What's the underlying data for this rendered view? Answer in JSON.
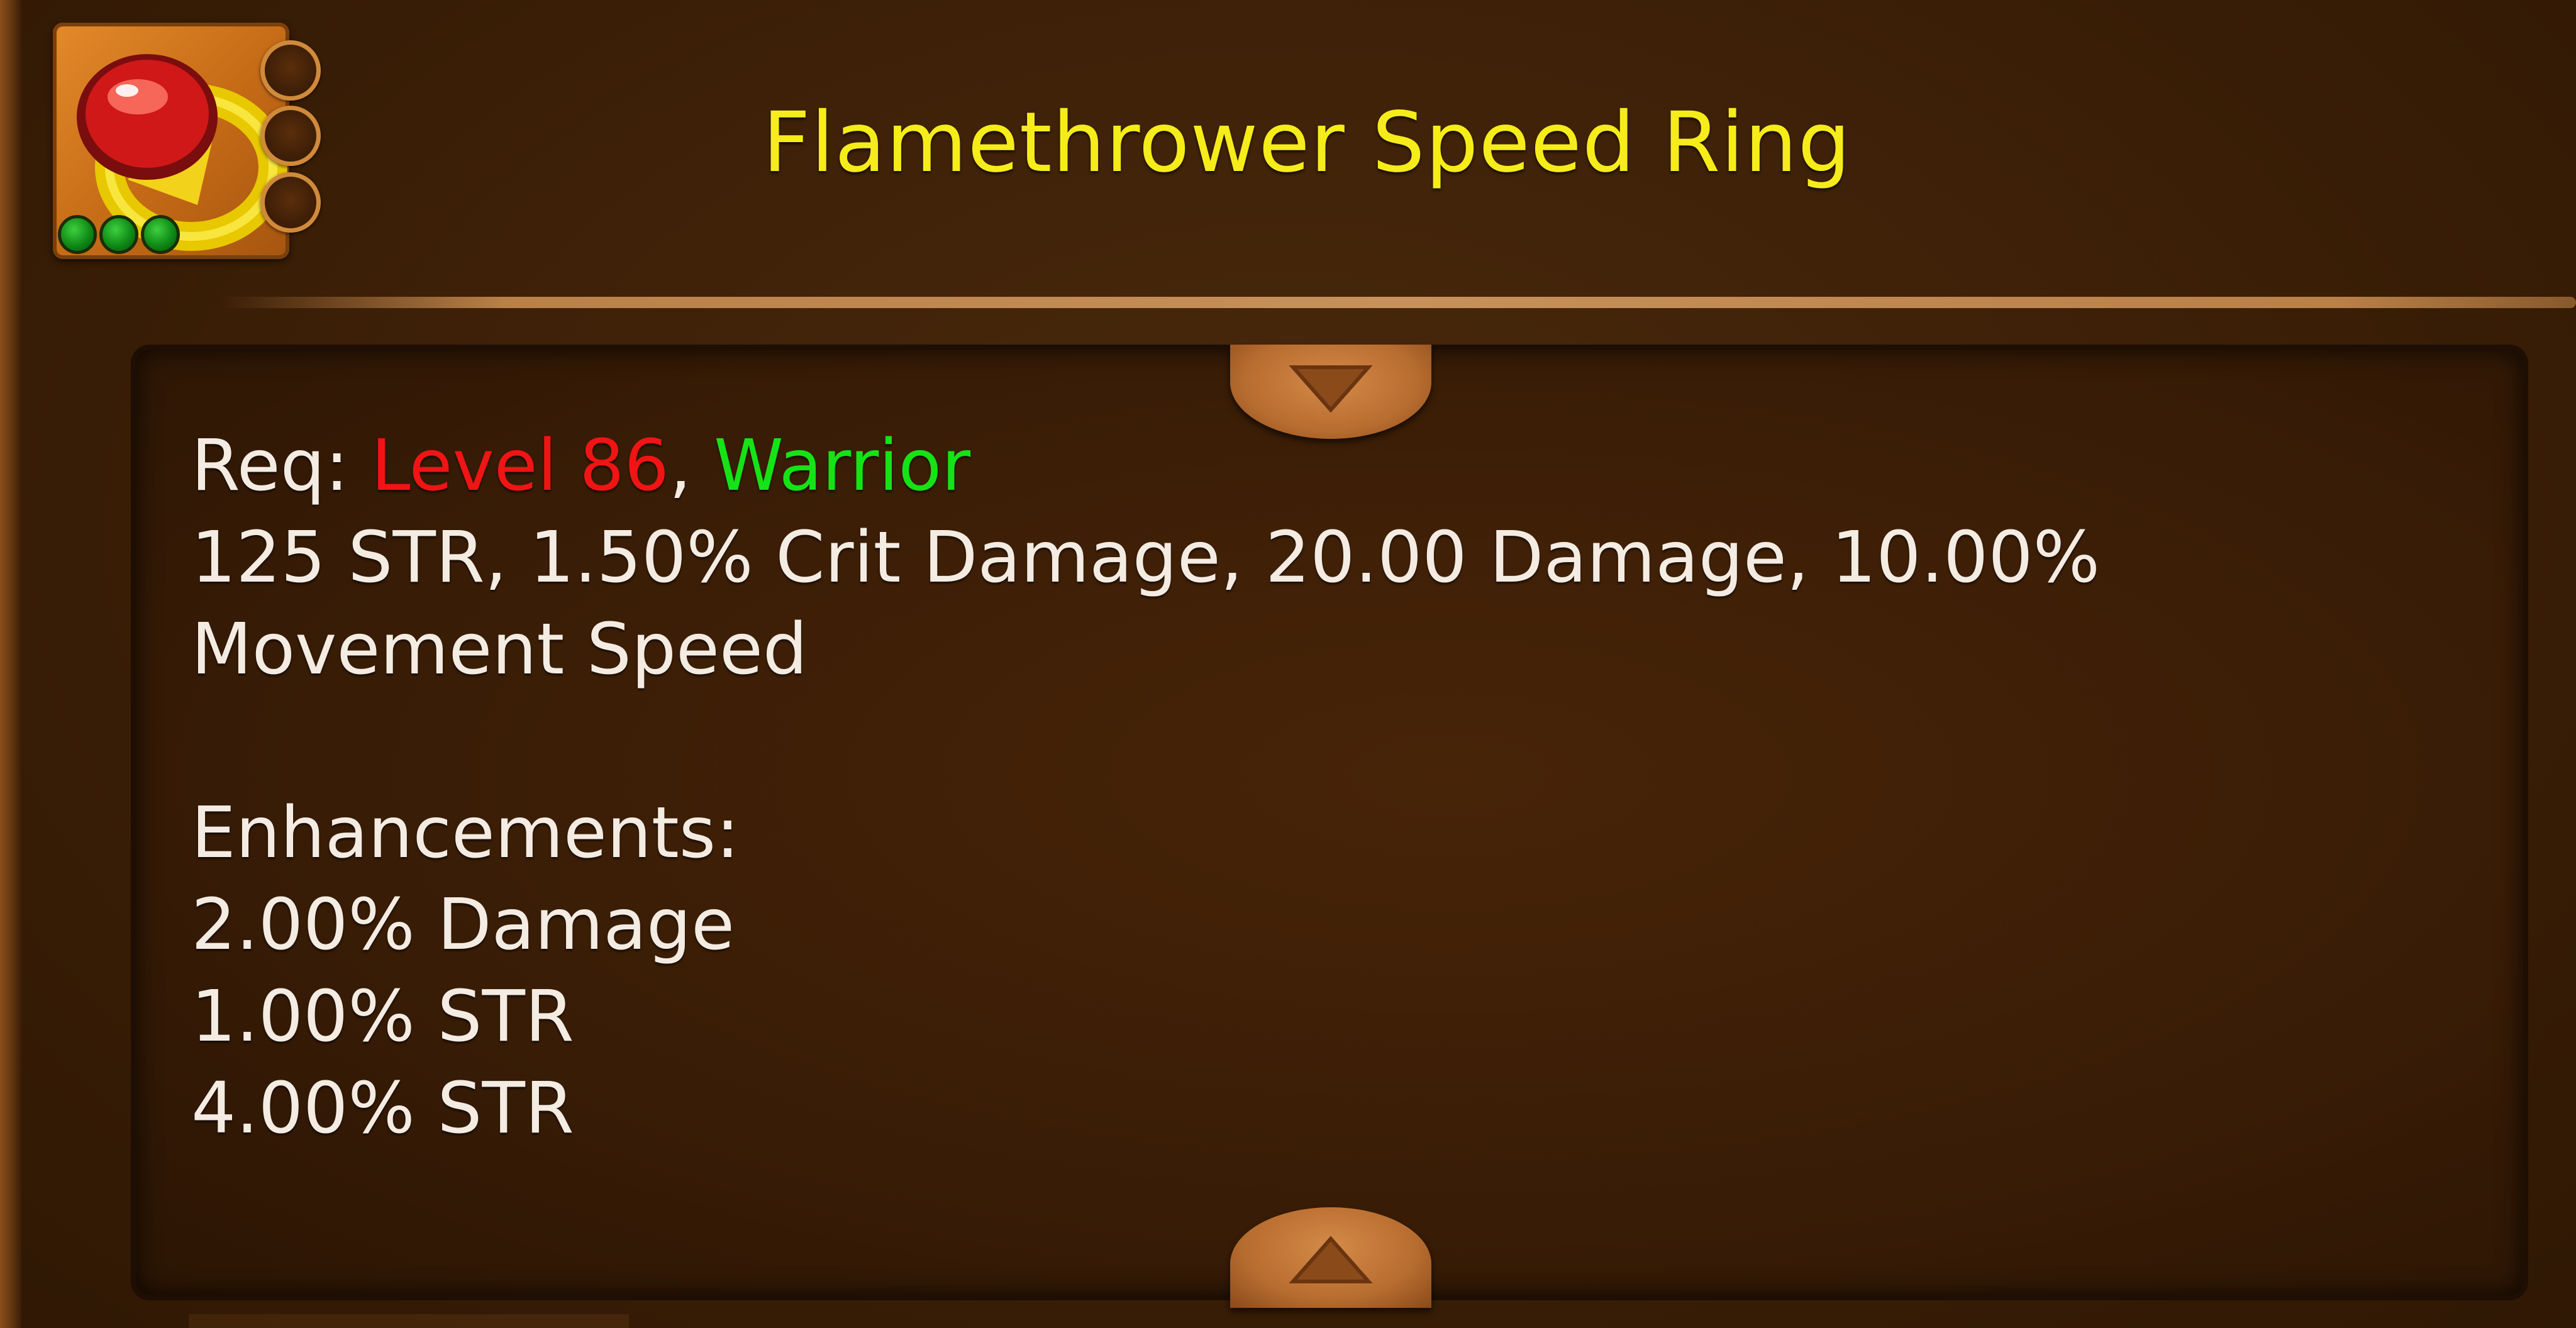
{
  "item": {
    "icon": "ring-icon",
    "name": "Flamethrower Speed Ring",
    "gem_count": 3,
    "socket_count": 3
  },
  "requirements": {
    "prefix": "Req: ",
    "level": "Level 86",
    "separator": ", ",
    "class": "Warrior"
  },
  "stats": "125 STR, 1.50% Crit Damage, 20.00 Damage, 10.00% Movement Speed",
  "enhancements": {
    "heading": "Enhancements:",
    "items": [
      "2.00% Damage",
      "1.00% STR",
      "4.00% STR"
    ]
  },
  "colors": {
    "title": "#f6ec1a",
    "level_requirement": "#f01414",
    "class_requirement": "#16e316",
    "body_text": "#f4ece2"
  },
  "controls": {
    "scroll_up_icon": "chevron-down-icon",
    "scroll_down_icon": "chevron-up-icon"
  }
}
